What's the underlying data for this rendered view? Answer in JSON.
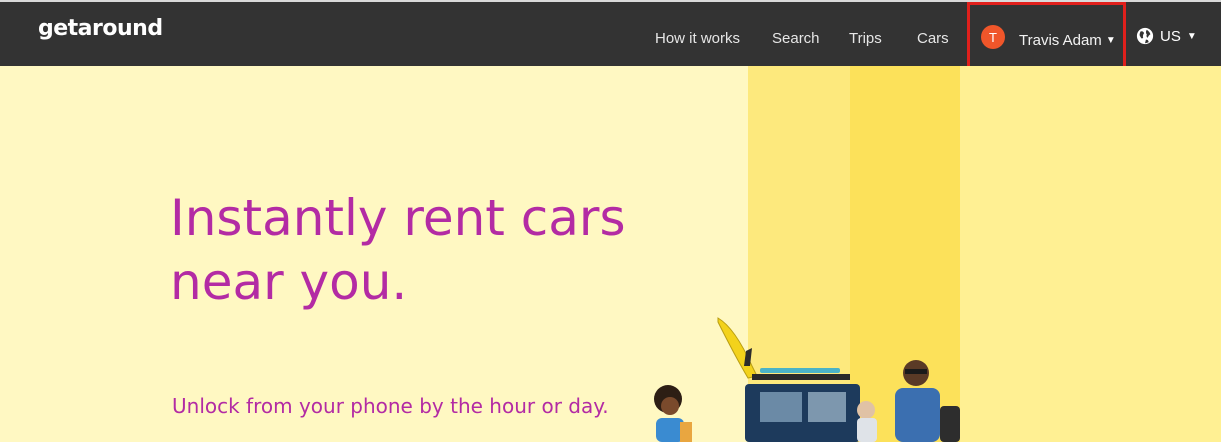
{
  "header": {
    "logo": "getaround",
    "nav": {
      "how_it_works": "How it works",
      "search": "Search",
      "trips": "Trips",
      "cars": "Cars"
    },
    "user": {
      "avatar_initial": "T",
      "name": "Travis Adam"
    },
    "locale": "US"
  },
  "hero": {
    "headline": "Instantly rent cars near you.",
    "subhead": "Unlock from your phone by the hour or day."
  },
  "colors": {
    "topbar": "#333333",
    "avatar": "#f0562a",
    "headline": "#b32ba4",
    "hero_bg": "#fff8c2",
    "highlight": "#e0201c"
  }
}
